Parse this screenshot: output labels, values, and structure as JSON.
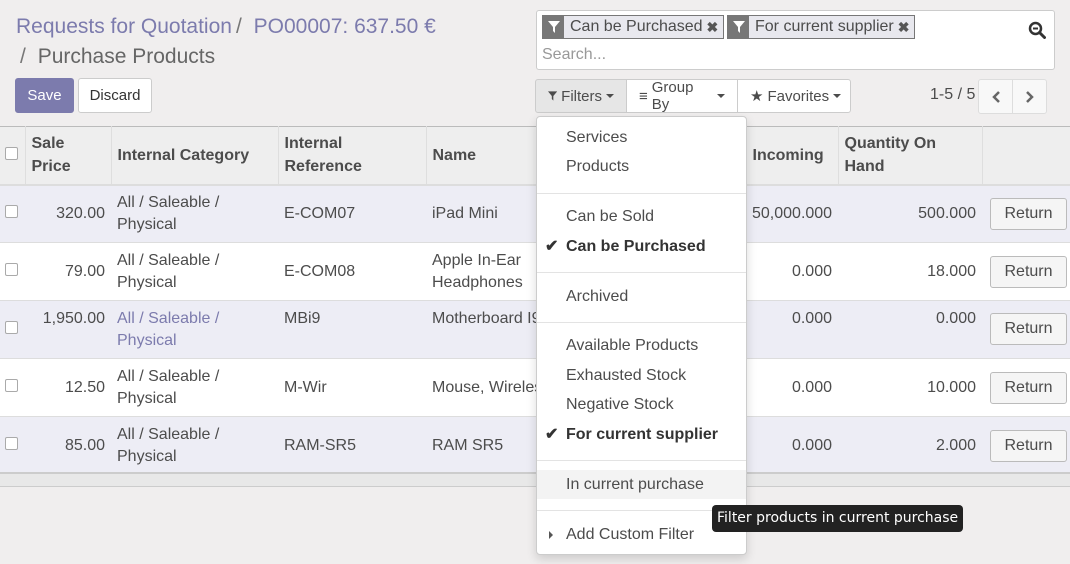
{
  "breadcrumb": {
    "items": [
      {
        "label": "Requests for Quotation"
      },
      {
        "label": "PO00007: 637.50 €"
      },
      {
        "label": "Purchase Products"
      }
    ],
    "separator": "/"
  },
  "actions": {
    "save_label": "Save",
    "discard_label": "Discard"
  },
  "search": {
    "facets": [
      {
        "icon": "filter-icon",
        "label": "Can be Purchased"
      },
      {
        "icon": "filter-icon",
        "label": "For current supplier"
      }
    ],
    "placeholder": "Search...",
    "remove_glyph": "✖"
  },
  "toolbar": {
    "filters_label": "Filters",
    "groupby_label": "Group By",
    "favorites_label": "Favorites"
  },
  "pager": {
    "value": "1-5 / 5",
    "prev": "‹",
    "next": "›"
  },
  "table": {
    "columns": [
      "Sale Price",
      "Internal Category",
      "Internal Reference",
      "Name",
      "",
      "Incoming",
      "Quantity On Hand",
      ""
    ],
    "column_header_lines": {
      "sale_price": [
        "Sale",
        "Price"
      ],
      "internal_reference": [
        "Internal",
        "Reference"
      ],
      "qty_on_hand": [
        "Quantity On",
        "Hand"
      ]
    },
    "rows": [
      {
        "sale_price": "320.00",
        "category": "All / Saleable / Physical",
        "reference": "E-COM07",
        "name": "iPad Mini",
        "incoming": "50,000.000",
        "qty_on_hand": "500.000",
        "action": "Return"
      },
      {
        "sale_price": "79.00",
        "category": "All / Saleable / Physical",
        "reference": "E-COM08",
        "name": "Apple In-Ear Headphones",
        "incoming": "0.000",
        "qty_on_hand": "18.000",
        "action": "Return"
      },
      {
        "sale_price": "1,950.00",
        "category": "All / Saleable / Physical",
        "reference": "MBi9",
        "name": "Motherboard I9",
        "incoming": "0.000",
        "qty_on_hand": "0.000",
        "action": "Return"
      },
      {
        "sale_price": "12.50",
        "category": "All / Saleable / Physical",
        "reference": "M-Wir",
        "name": "Mouse, Wireless",
        "incoming": "0.000",
        "qty_on_hand": "10.000",
        "action": "Return"
      },
      {
        "sale_price": "85.00",
        "category": "All / Saleable / Physical",
        "reference": "RAM-SR5",
        "name": "RAM SR5",
        "incoming": "0.000",
        "qty_on_hand": "2.000",
        "action": "Return"
      }
    ]
  },
  "filters_menu": {
    "groups": [
      [
        {
          "label": "Services",
          "selected": false
        },
        {
          "label": "Products",
          "selected": false
        }
      ],
      [
        {
          "label": "Can be Sold",
          "selected": false
        },
        {
          "label": "Can be Purchased",
          "selected": true
        }
      ],
      [
        {
          "label": "Archived",
          "selected": false
        }
      ],
      [
        {
          "label": "Available Products",
          "selected": false
        },
        {
          "label": "Exhausted Stock",
          "selected": false
        },
        {
          "label": "Negative Stock",
          "selected": false
        },
        {
          "label": "For current supplier",
          "selected": true
        }
      ],
      [
        {
          "label": "In current purchase",
          "selected": false,
          "hovered": true
        }
      ],
      [
        {
          "label": "Add Custom Filter",
          "selected": false
        }
      ]
    ],
    "check_glyph": "✔"
  },
  "tooltip": {
    "text": "Filter products in current purchase"
  },
  "colors": {
    "accent": "#7c7bad",
    "background": "#f0eeee",
    "odd_row": "#ededf5",
    "tooltip_bg": "#222222"
  }
}
